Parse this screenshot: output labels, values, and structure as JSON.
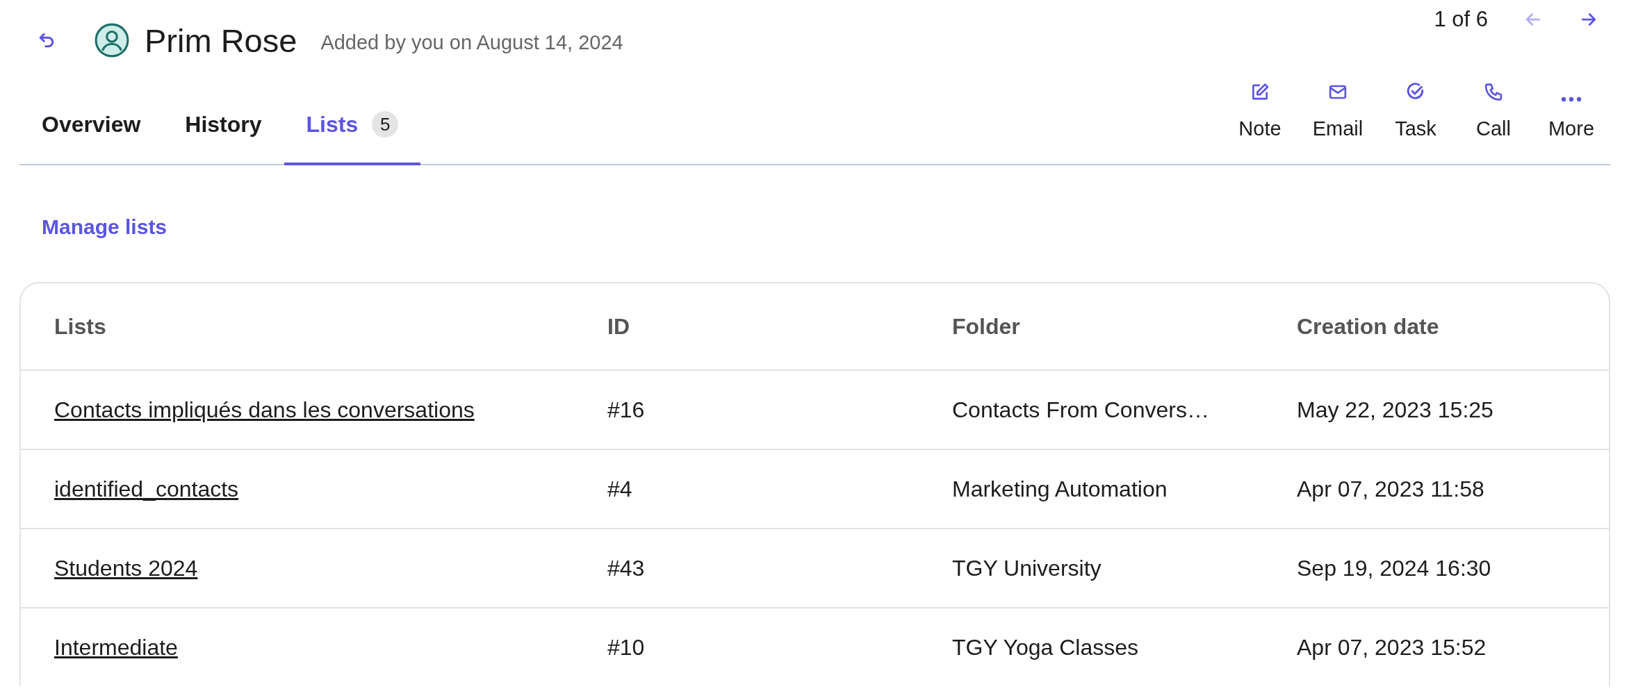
{
  "header": {
    "name": "Prim Rose",
    "subtitle": "Added by you on August 14, 2024"
  },
  "pager": {
    "text": "1 of 6",
    "prev_disabled": true,
    "next_disabled": false
  },
  "tabs": [
    {
      "label": "Overview",
      "selected": false
    },
    {
      "label": "History",
      "selected": false
    },
    {
      "label": "Lists",
      "selected": true,
      "count": "5"
    }
  ],
  "actions": [
    {
      "kind": "note",
      "label": "Note"
    },
    {
      "kind": "email",
      "label": "Email"
    },
    {
      "kind": "task",
      "label": "Task"
    },
    {
      "kind": "call",
      "label": "Call"
    },
    {
      "kind": "more",
      "label": "More"
    }
  ],
  "manage_link": "Manage lists",
  "table": {
    "columns": [
      "Lists",
      "ID",
      "Folder",
      "Creation date"
    ],
    "rows": [
      [
        "Contacts impliqués dans les conversations",
        "#16",
        "Contacts From Convers…",
        "May 22, 2023 15:25"
      ],
      [
        "identified_contacts",
        "#4",
        "Marketing Automation",
        "Apr 07, 2023 11:58"
      ],
      [
        "Students 2024",
        "#43",
        "TGY University",
        "Sep 19, 2024 16:30"
      ],
      [
        "Intermediate",
        "#10",
        "TGY Yoga Classes",
        "Apr 07, 2023 15:52"
      ]
    ]
  }
}
